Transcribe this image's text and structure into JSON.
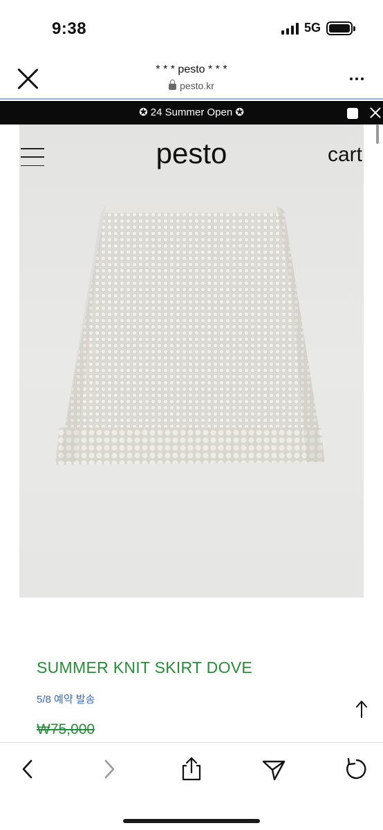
{
  "status_bar": {
    "time": "9:38",
    "network": "5G",
    "battery_level": 1.0
  },
  "browser": {
    "title": "* * * pesto * * *",
    "url": "pesto.kr",
    "close_icon": "close-icon",
    "more_icon": "more-icon"
  },
  "banner": {
    "text": "✪ 24 Summer Open ✪"
  },
  "site": {
    "logo": "pesto",
    "cart_label": "cart",
    "menu_icon": "hamburger-icon"
  },
  "product": {
    "name": "SUMMER KNIT SKIRT DOVE",
    "note": "5/8 예약 발송",
    "price": "₩75,000",
    "price_struck": true
  },
  "toolbar": {
    "back_icon": "back-icon",
    "forward_icon": "forward-icon",
    "share_icon": "share-icon",
    "send_icon": "send-icon",
    "reload_icon": "reload-icon"
  },
  "colors": {
    "accent_green": "#2a8a3a",
    "note_blue": "#3a68b0",
    "banner_bg": "#0b0b0b",
    "divider_blue": "#8fb4d6"
  }
}
